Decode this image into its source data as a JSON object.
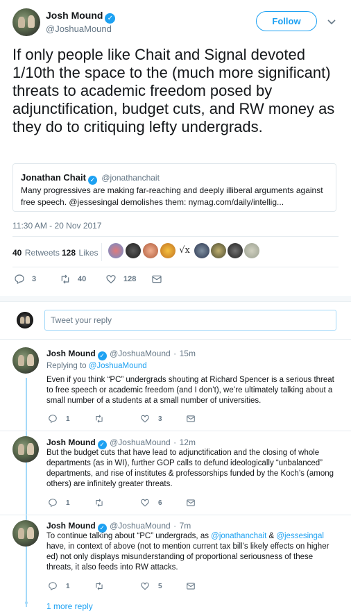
{
  "tweet": {
    "author_name": "Josh Mound",
    "author_handle": "@JoshuaMound",
    "follow_label": "Follow",
    "text": "If only people like Chait and Signal devoted 1/10th the space to the (much more significant) threats to academic freedom posed by adjunctification, budget cuts, and RW money as they do to critiquing lefty undergrads.",
    "quote": {
      "name": "Jonathan Chait",
      "handle": "@jonathanchait",
      "text": "Many progressives are making far-reaching and deeply illiberal arguments against free speech. @jessesingal demolishes them: nymag.com/daily/intellig..."
    },
    "timestamp": "11:30 AM - 20 Nov 2017",
    "retweets_count": "40",
    "retweets_label": "Retweets",
    "likes_count": "128",
    "likes_label": "Likes",
    "actions": {
      "replies": "3",
      "retweets": "40",
      "likes": "128"
    }
  },
  "reply_box": {
    "placeholder": "Tweet your reply"
  },
  "replies": [
    {
      "name": "Josh Mound",
      "handle": "@JoshuaMound",
      "sep": "·",
      "time": "15m",
      "replying_prefix": "Replying to ",
      "replying_to": "@JoshuaMound",
      "text": "Even if you think “PC” undergrads shouting at Richard Spencer is a serious threat to free speech or academic freedom (and I don’t), we’re ultimately talking about a small number of a students at a small number of universities.",
      "reply_count": "1",
      "retweet_count": "",
      "like_count": "3"
    },
    {
      "name": "Josh Mound",
      "handle": "@JoshuaMound",
      "sep": "·",
      "time": "12m",
      "text": "But the budget cuts that have lead to adjunctification and the closing of whole departments (as in WI), further GOP calls to defund ideologically “unbalanced” departments, and rise of institutes & professorships funded by the Koch’s (among others)  are infinitely greater threats.",
      "reply_count": "1",
      "retweet_count": "",
      "like_count": "6"
    },
    {
      "name": "Josh Mound",
      "handle": "@JoshuaMound",
      "sep": "·",
      "time": "7m",
      "text_1": "To continue talking about “PC” undergrads, as ",
      "mention_1": "@jonathanchait",
      "text_2": " & ",
      "mention_2": "@jessesingal",
      "text_3": " have, in context of above (not to mention current tax bill’s likely effects on higher ed) not only displays misunderstanding of proportional seriousness of these threats, it also feeds into RW attacks.",
      "reply_count": "1",
      "retweet_count": "",
      "like_count": "5"
    }
  ],
  "more_replies_label": "1 more reply",
  "colors": {
    "accent": "#1da1f2",
    "text": "#14171a",
    "muted": "#657786",
    "border": "#e6ecf0"
  },
  "icons": [
    "verified-icon",
    "chevron-down-icon",
    "reply-icon",
    "retweet-icon",
    "like-icon",
    "message-icon",
    "sqrt-icon"
  ]
}
